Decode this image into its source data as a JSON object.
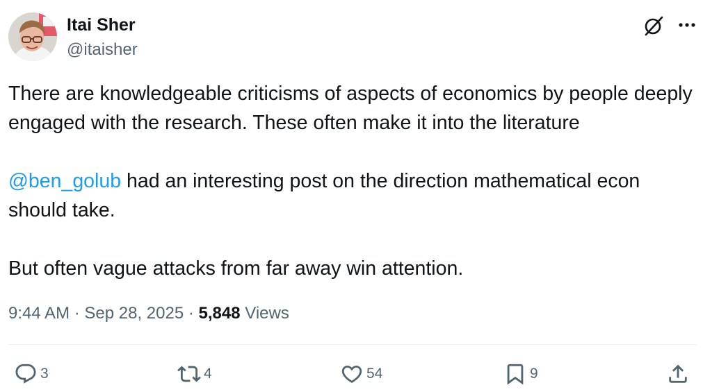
{
  "author": {
    "name": "Itai Sher",
    "handle": "@itaisher"
  },
  "tweet": {
    "line1": "There are knowledgeable criticisms of aspects of economics by people deeply engaged with the research. These often make it into the literature",
    "mention": "@ben_golub",
    "line2_rest": " had an interesting post on the direction mathematical econ should take.",
    "line3": "But often vague attacks from far away win attention."
  },
  "meta": {
    "time": "9:44 AM",
    "separator": " · ",
    "date": "Sep 28, 2025",
    "views_count": "5,848",
    "views_label": " Views"
  },
  "actions": {
    "replies": "3",
    "reposts": "4",
    "likes": "54",
    "bookmarks": "9"
  },
  "icons": {
    "header": [
      "grok-icon",
      "more-icon"
    ],
    "actions": [
      "reply-icon",
      "repost-icon",
      "like-icon",
      "bookmark-icon",
      "share-icon"
    ]
  },
  "colors": {
    "text": "#0f1419",
    "secondary": "#536471",
    "link": "#1d9bf0",
    "divider": "#eff3f4"
  }
}
